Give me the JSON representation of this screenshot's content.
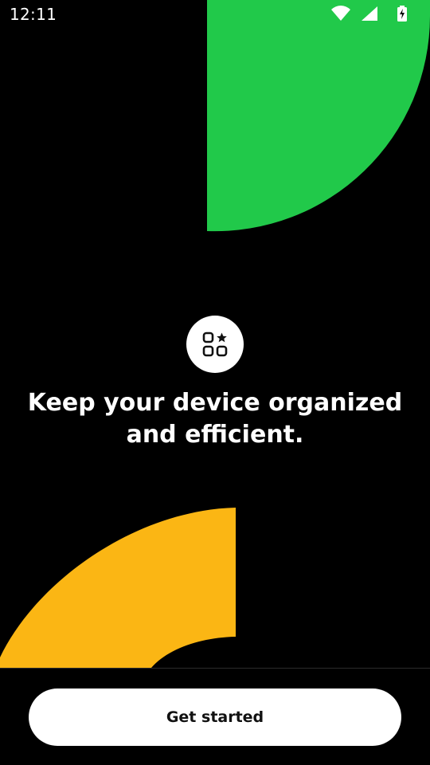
{
  "status_bar": {
    "time": "12:11",
    "icons": [
      "wifi-icon",
      "cellular-signal-icon",
      "battery-charging-icon"
    ]
  },
  "onboarding": {
    "app_icon": "apps-grid-star-icon",
    "headline_line1": "Keep your device organized",
    "headline_line2": "and efficient.",
    "cta_label": "Get started"
  },
  "colors": {
    "background": "#000000",
    "accent_green": "#21C94A",
    "accent_yellow": "#FBB614",
    "button_bg": "#FFFFFF",
    "button_text": "#111111"
  }
}
